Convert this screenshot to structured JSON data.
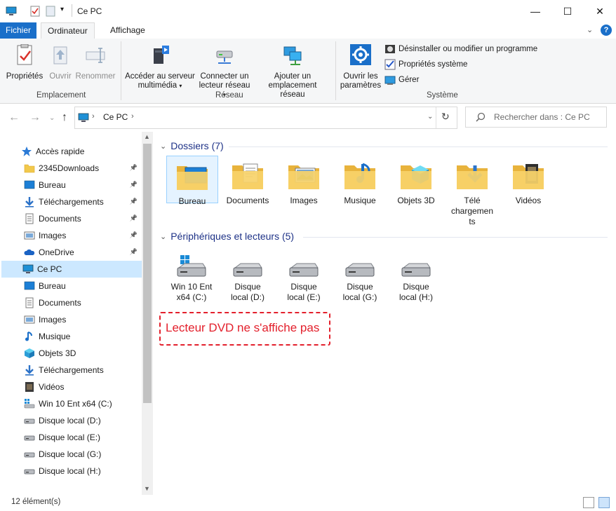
{
  "window": {
    "title": "Ce PC",
    "controls": {
      "minimize": "—",
      "maximize": "☐",
      "close": "✕"
    }
  },
  "tabs": [
    {
      "label": "Fichier"
    },
    {
      "label": "Ordinateur"
    },
    {
      "label": "Affichage"
    }
  ],
  "ribbon": {
    "groups": {
      "location": "Emplacement",
      "network": "Réseau",
      "system": "Système"
    },
    "buttons": {
      "properties": "Propriétés",
      "open": "Ouvrir",
      "rename": "Renommer",
      "media_server_1": "Accéder au serveur",
      "media_server_2": "multimédia",
      "map_drive_1": "Connecter un",
      "map_drive_2": "lecteur réseau",
      "add_location_1": "Ajouter un",
      "add_location_2": "emplacement réseau",
      "open_settings_1": "Ouvrir les",
      "open_settings_2": "paramètres"
    },
    "small": {
      "uninstall": "Désinstaller ou modifier un programme",
      "system_props": "Propriétés système",
      "manage": "Gérer"
    },
    "colors": {
      "accent": "#1a6fc9"
    }
  },
  "address": {
    "root": "Ce PC",
    "search_placeholder": "Rechercher dans : Ce PC"
  },
  "nav": {
    "items": [
      {
        "label": "Accès rapide",
        "icon": "star-icon",
        "pinned": false
      },
      {
        "label": "2345Downloads",
        "icon": "folder-icon",
        "pinned": true
      },
      {
        "label": "Bureau",
        "icon": "desktop-icon",
        "pinned": true
      },
      {
        "label": "Téléchargements",
        "icon": "download-icon",
        "pinned": true
      },
      {
        "label": "Documents",
        "icon": "documents-icon",
        "pinned": true
      },
      {
        "label": "Images",
        "icon": "images-icon",
        "pinned": true
      },
      {
        "label": "OneDrive",
        "icon": "onedrive-icon",
        "pinned": true
      },
      {
        "label": "Ce PC",
        "icon": "pc-icon",
        "pinned": false
      },
      {
        "label": "Bureau",
        "icon": "desktop-icon",
        "pinned": false
      },
      {
        "label": "Documents",
        "icon": "documents-icon",
        "pinned": false
      },
      {
        "label": "Images",
        "icon": "images-icon",
        "pinned": false
      },
      {
        "label": "Musique",
        "icon": "music-icon",
        "pinned": false
      },
      {
        "label": "Objets 3D",
        "icon": "objects3d-icon",
        "pinned": false
      },
      {
        "label": "Téléchargements",
        "icon": "download-icon",
        "pinned": false
      },
      {
        "label": "Vidéos",
        "icon": "video-icon",
        "pinned": false
      },
      {
        "label": "Win 10 Ent x64 (C:)",
        "icon": "system-drive-icon",
        "pinned": false
      },
      {
        "label": "Disque local (D:)",
        "icon": "drive-icon",
        "pinned": false
      },
      {
        "label": "Disque local (E:)",
        "icon": "drive-icon",
        "pinned": false
      },
      {
        "label": "Disque local (G:)",
        "icon": "drive-icon",
        "pinned": false
      },
      {
        "label": "Disque local (H:)",
        "icon": "drive-icon",
        "pinned": false
      }
    ]
  },
  "content": {
    "folders_header": "Dossiers (7)",
    "folders": [
      {
        "label": "Bureau",
        "icon": "desktop-icon"
      },
      {
        "label": "Documents",
        "icon": "documents-icon"
      },
      {
        "label": "Images",
        "icon": "images-icon"
      },
      {
        "label": "Musique",
        "icon": "music-icon"
      },
      {
        "label": "Objets 3D",
        "icon": "objects3d-icon"
      },
      {
        "label": "Télé\nchargemen\nts",
        "icon": "download-icon"
      },
      {
        "label": "Vidéos",
        "icon": "video-icon"
      }
    ],
    "devices_header": "Périphériques et lecteurs (5)",
    "drives": [
      {
        "label": "Win 10 Ent\nx64 (C:)",
        "icon": "system-drive-icon"
      },
      {
        "label": "Disque\nlocal (D:)",
        "icon": "drive-icon"
      },
      {
        "label": "Disque\nlocal (E:)",
        "icon": "drive-icon"
      },
      {
        "label": "Disque\nlocal (G:)",
        "icon": "drive-icon"
      },
      {
        "label": "Disque\nlocal (H:)",
        "icon": "drive-icon"
      }
    ],
    "annotation": "Lecteur DVD ne s'affiche pas"
  },
  "status": {
    "count": "12 élément(s)"
  }
}
